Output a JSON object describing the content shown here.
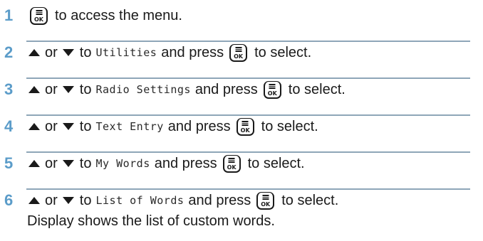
{
  "accent_color": "#5b9cc9",
  "divider_color": "#8ea6b8",
  "key_label": "OK",
  "steps": [
    {
      "number": "1",
      "text": "to access the menu."
    },
    {
      "number": "2",
      "connector_or": "or",
      "connector_to": "to",
      "menu_item": "Utilities",
      "press": "and press",
      "after": "to select."
    },
    {
      "number": "3",
      "connector_or": "or",
      "connector_to": "to",
      "menu_item": "Radio Settings",
      "press": "and press",
      "after": "to select."
    },
    {
      "number": "4",
      "connector_or": "or",
      "connector_to": "to",
      "menu_item": "Text Entry",
      "press": "and press",
      "after": "to select."
    },
    {
      "number": "5",
      "connector_or": "or",
      "connector_to": "to",
      "menu_item": "My Words",
      "press": "and press",
      "after": "to select."
    },
    {
      "number": "6",
      "connector_or": "or",
      "connector_to": "to",
      "menu_item": "List of Words",
      "press": "and press",
      "after": "to select.",
      "note": "Display shows the list of custom words."
    }
  ]
}
